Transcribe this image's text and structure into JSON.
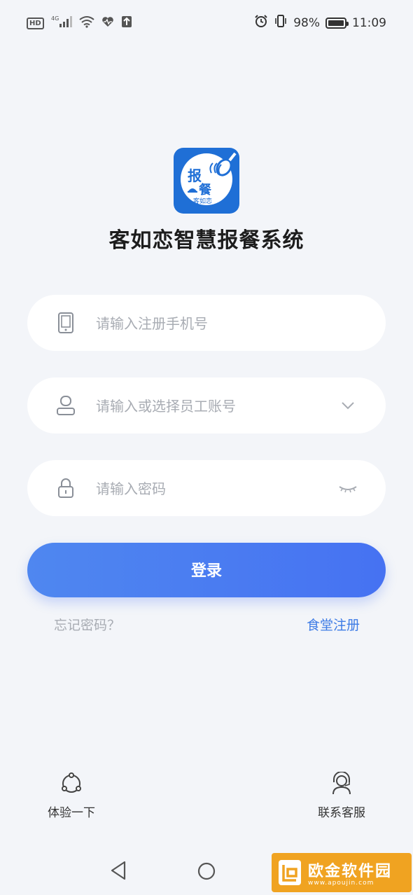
{
  "status_bar": {
    "hd": "HD",
    "signal": "4G",
    "battery_pct": "98%",
    "battery_level": 0.98,
    "time": "11:09"
  },
  "logo": {
    "line1": "报",
    "line2": "餐",
    "caption": "客如恋"
  },
  "app_title": "客如恋智慧报餐系统",
  "form": {
    "phone_placeholder": "请输入注册手机号",
    "account_placeholder": "请输入或选择员工账号",
    "password_placeholder": "请输入密码",
    "login_label": "登录",
    "forgot_label": "忘记密码？",
    "register_label": "食堂注册"
  },
  "bottom": {
    "trial_label": "体验一下",
    "support_label": "联系客服"
  },
  "watermark": {
    "text": "欧金软件园",
    "sub": "www.apoujin.com"
  },
  "colors": {
    "primary": "#4672f2",
    "link": "#3d7be5",
    "background": "#f3f5f9",
    "logo_blue": "#1f6fd6"
  }
}
